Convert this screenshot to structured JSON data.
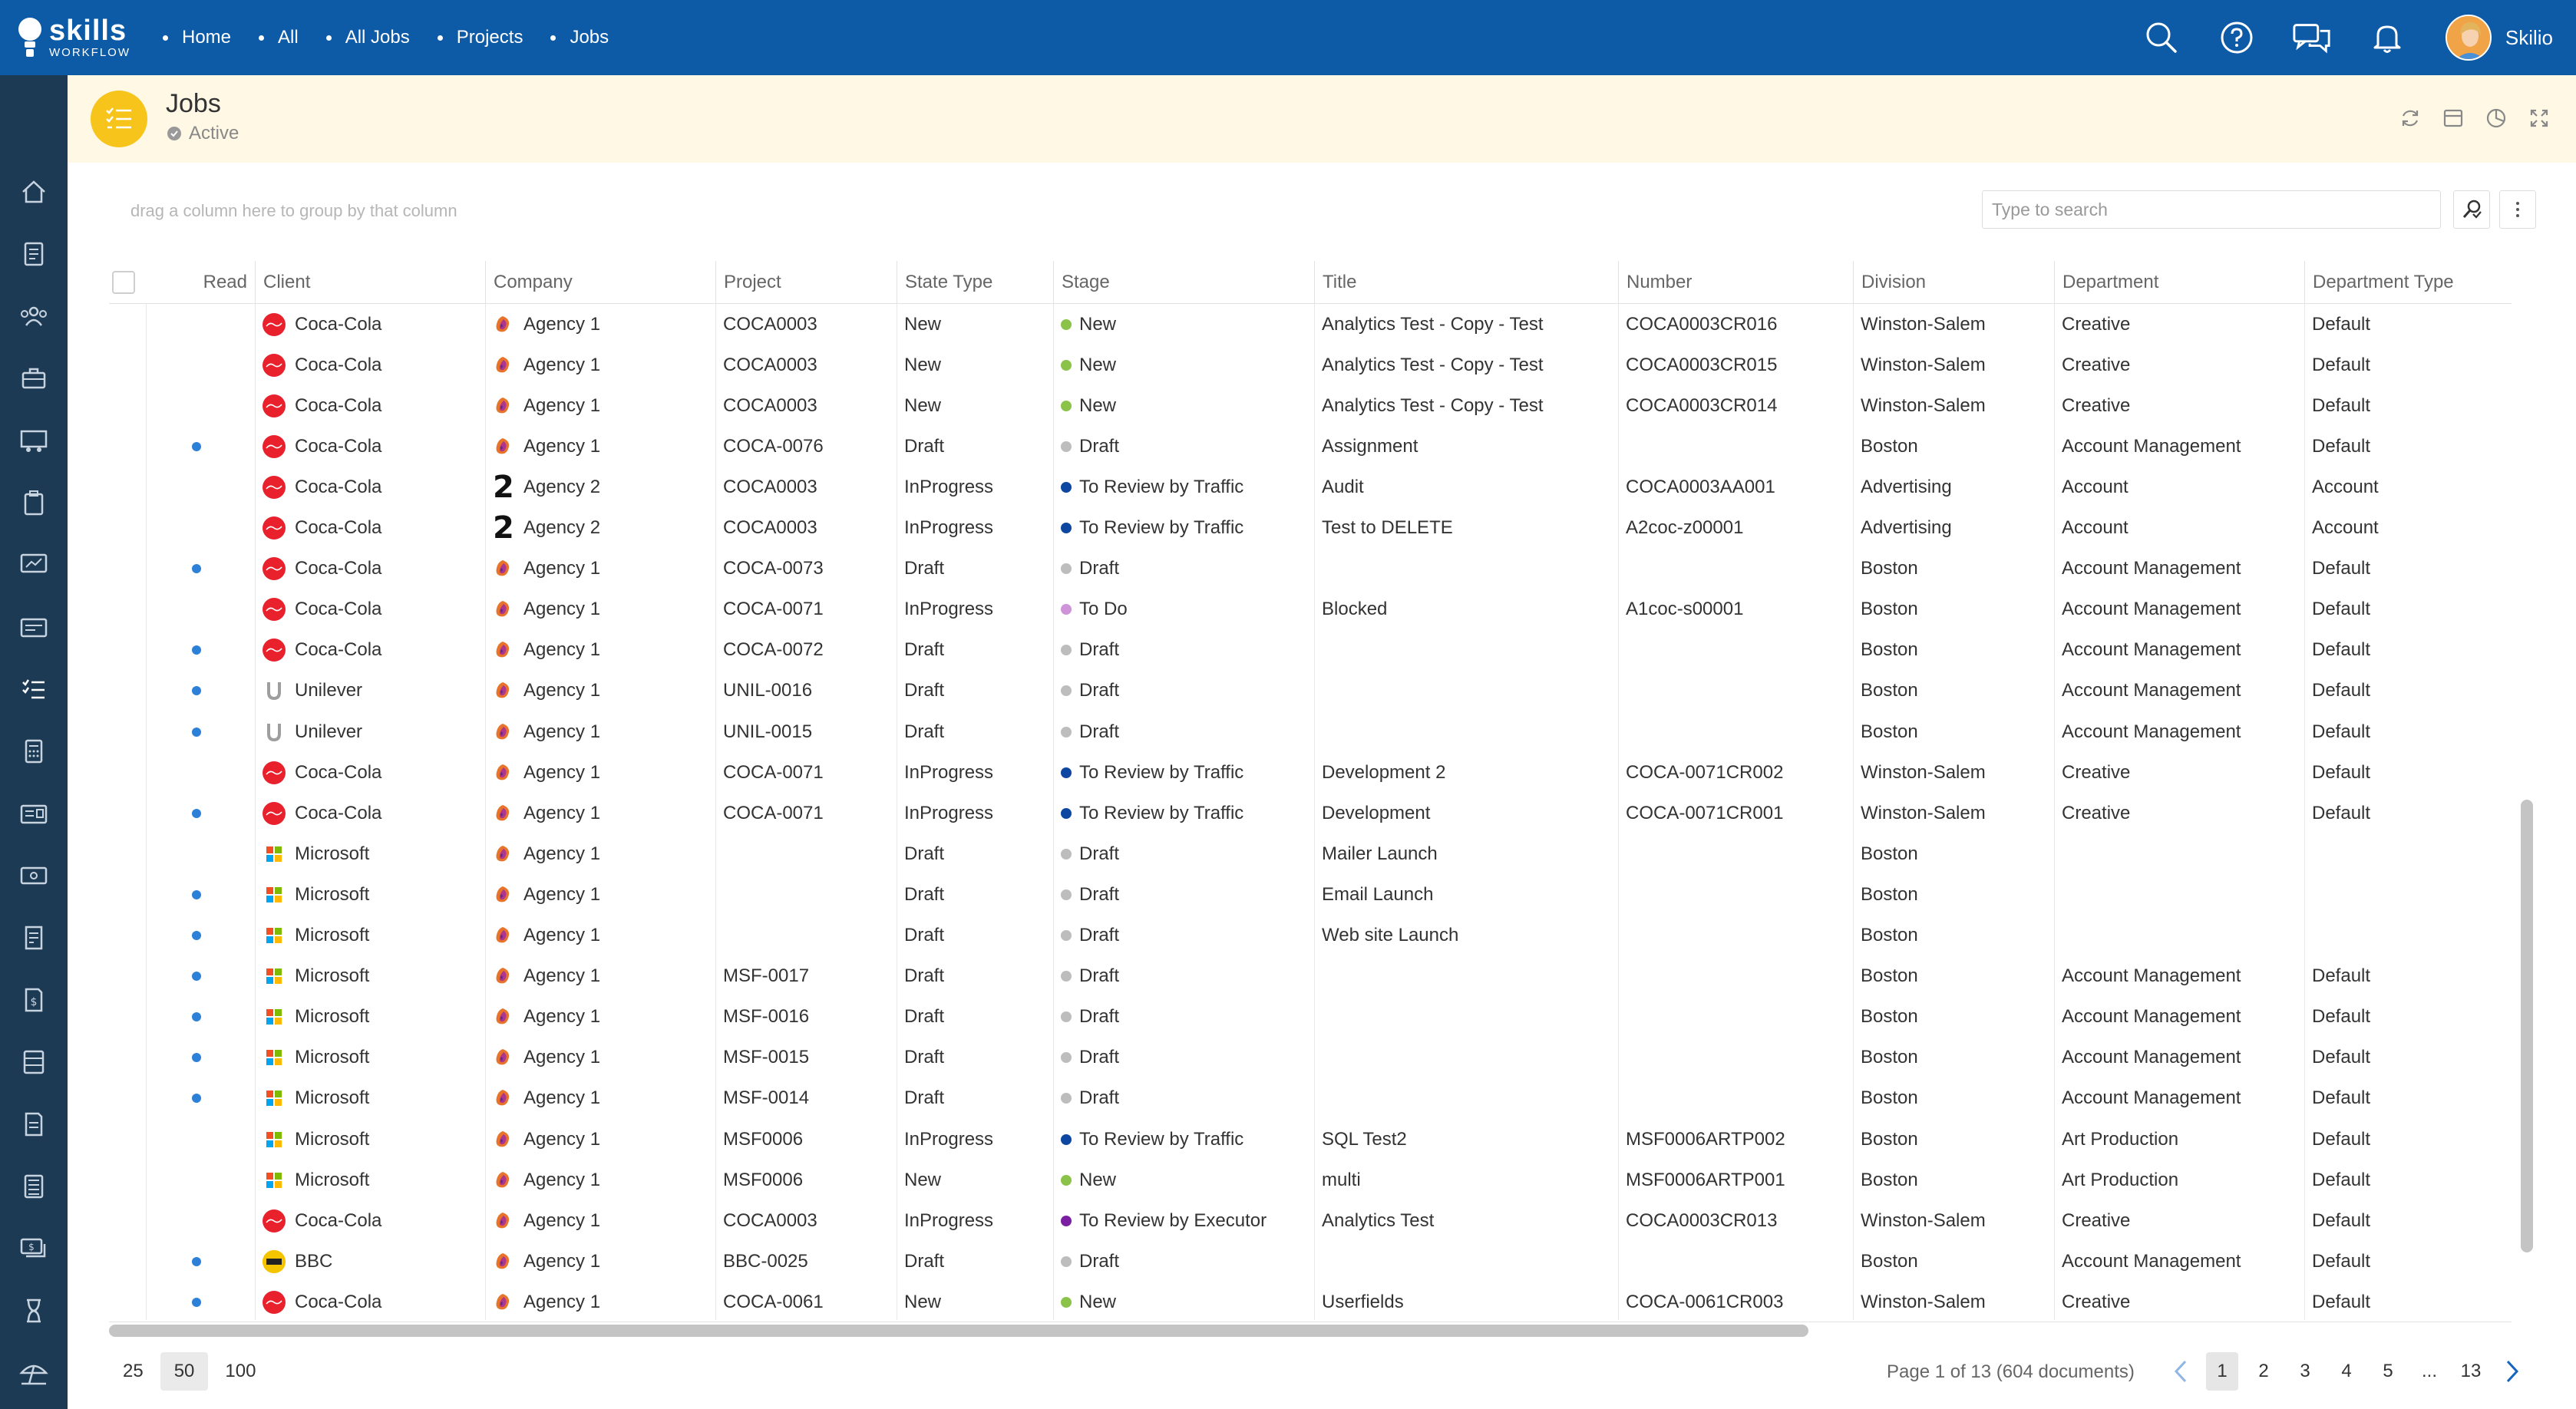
{
  "app": {
    "logo_line1": "skills",
    "logo_line2": "WORKFLOW"
  },
  "breadcrumbs": [
    "Home",
    "All",
    "All Jobs",
    "Projects",
    "Jobs"
  ],
  "user": {
    "name": "Skilio"
  },
  "page": {
    "title": "Jobs",
    "status": "Active"
  },
  "toolbar": {
    "group_hint": "drag a column here to group by that column",
    "search_placeholder": "Type to search"
  },
  "columns": [
    "Read",
    "Client",
    "Company",
    "Project",
    "State Type",
    "Stage",
    "Title",
    "Number",
    "Division",
    "Department",
    "Department Type"
  ],
  "stage_colors": {
    "New": "#8bc34a",
    "Draft": "#bdbdbd",
    "To Review by Traffic": "#0d47a1",
    "To Do": "#ce93d8",
    "To Review by Executor": "#7b1fa2"
  },
  "rows": [
    {
      "read": false,
      "client": "Coca-Cola",
      "company": "Agency 1",
      "project": "COCA0003",
      "state_type": "New",
      "stage": "New",
      "title": "Analytics Test - Copy - Test",
      "number": "COCA0003CR016",
      "division": "Winston-Salem",
      "department": "Creative",
      "department_type": "Default"
    },
    {
      "read": false,
      "client": "Coca-Cola",
      "company": "Agency 1",
      "project": "COCA0003",
      "state_type": "New",
      "stage": "New",
      "title": "Analytics Test - Copy - Test",
      "number": "COCA0003CR015",
      "division": "Winston-Salem",
      "department": "Creative",
      "department_type": "Default"
    },
    {
      "read": false,
      "client": "Coca-Cola",
      "company": "Agency 1",
      "project": "COCA0003",
      "state_type": "New",
      "stage": "New",
      "title": "Analytics Test - Copy - Test",
      "number": "COCA0003CR014",
      "division": "Winston-Salem",
      "department": "Creative",
      "department_type": "Default"
    },
    {
      "read": true,
      "client": "Coca-Cola",
      "company": "Agency 1",
      "project": "COCA-0076",
      "state_type": "Draft",
      "stage": "Draft",
      "title": "Assignment",
      "number": "",
      "division": "Boston",
      "department": "Account Management",
      "department_type": "Default"
    },
    {
      "read": false,
      "client": "Coca-Cola",
      "company": "Agency 2",
      "project": "COCA0003",
      "state_type": "InProgress",
      "stage": "To Review by Traffic",
      "title": "Audit",
      "number": "COCA0003AA001",
      "division": "Advertising",
      "department": "Account",
      "department_type": "Account"
    },
    {
      "read": false,
      "client": "Coca-Cola",
      "company": "Agency 2",
      "project": "COCA0003",
      "state_type": "InProgress",
      "stage": "To Review by Traffic",
      "title": "Test to DELETE",
      "number": "A2coc-z00001",
      "division": "Advertising",
      "department": "Account",
      "department_type": "Account"
    },
    {
      "read": true,
      "client": "Coca-Cola",
      "company": "Agency 1",
      "project": "COCA-0073",
      "state_type": "Draft",
      "stage": "Draft",
      "title": "",
      "number": "",
      "division": "Boston",
      "department": "Account Management",
      "department_type": "Default"
    },
    {
      "read": false,
      "client": "Coca-Cola",
      "company": "Agency 1",
      "project": "COCA-0071",
      "state_type": "InProgress",
      "stage": "To Do",
      "title": "Blocked",
      "number": "A1coc-s00001",
      "division": "Boston",
      "department": "Account Management",
      "department_type": "Default"
    },
    {
      "read": true,
      "client": "Coca-Cola",
      "company": "Agency 1",
      "project": "COCA-0072",
      "state_type": "Draft",
      "stage": "Draft",
      "title": "",
      "number": "",
      "division": "Boston",
      "department": "Account Management",
      "department_type": "Default"
    },
    {
      "read": true,
      "client": "Unilever",
      "company": "Agency 1",
      "project": "UNIL-0016",
      "state_type": "Draft",
      "stage": "Draft",
      "title": "",
      "number": "",
      "division": "Boston",
      "department": "Account Management",
      "department_type": "Default"
    },
    {
      "read": true,
      "client": "Unilever",
      "company": "Agency 1",
      "project": "UNIL-0015",
      "state_type": "Draft",
      "stage": "Draft",
      "title": "",
      "number": "",
      "division": "Boston",
      "department": "Account Management",
      "department_type": "Default"
    },
    {
      "read": false,
      "client": "Coca-Cola",
      "company": "Agency 1",
      "project": "COCA-0071",
      "state_type": "InProgress",
      "stage": "To Review by Traffic",
      "title": "Development 2",
      "number": "COCA-0071CR002",
      "division": "Winston-Salem",
      "department": "Creative",
      "department_type": "Default"
    },
    {
      "read": true,
      "client": "Coca-Cola",
      "company": "Agency 1",
      "project": "COCA-0071",
      "state_type": "InProgress",
      "stage": "To Review by Traffic",
      "title": "Development",
      "number": "COCA-0071CR001",
      "division": "Winston-Salem",
      "department": "Creative",
      "department_type": "Default"
    },
    {
      "read": false,
      "client": "Microsoft",
      "company": "Agency 1",
      "project": "",
      "state_type": "Draft",
      "stage": "Draft",
      "title": "Mailer Launch",
      "number": "",
      "division": "Boston",
      "department": "",
      "department_type": ""
    },
    {
      "read": true,
      "client": "Microsoft",
      "company": "Agency 1",
      "project": "",
      "state_type": "Draft",
      "stage": "Draft",
      "title": "Email Launch",
      "number": "",
      "division": "Boston",
      "department": "",
      "department_type": ""
    },
    {
      "read": true,
      "client": "Microsoft",
      "company": "Agency 1",
      "project": "",
      "state_type": "Draft",
      "stage": "Draft",
      "title": "Web site Launch",
      "number": "",
      "division": "Boston",
      "department": "",
      "department_type": ""
    },
    {
      "read": true,
      "client": "Microsoft",
      "company": "Agency 1",
      "project": "MSF-0017",
      "state_type": "Draft",
      "stage": "Draft",
      "title": "",
      "number": "",
      "division": "Boston",
      "department": "Account Management",
      "department_type": "Default"
    },
    {
      "read": true,
      "client": "Microsoft",
      "company": "Agency 1",
      "project": "MSF-0016",
      "state_type": "Draft",
      "stage": "Draft",
      "title": "",
      "number": "",
      "division": "Boston",
      "department": "Account Management",
      "department_type": "Default"
    },
    {
      "read": true,
      "client": "Microsoft",
      "company": "Agency 1",
      "project": "MSF-0015",
      "state_type": "Draft",
      "stage": "Draft",
      "title": "",
      "number": "",
      "division": "Boston",
      "department": "Account Management",
      "department_type": "Default"
    },
    {
      "read": true,
      "client": "Microsoft",
      "company": "Agency 1",
      "project": "MSF-0014",
      "state_type": "Draft",
      "stage": "Draft",
      "title": "",
      "number": "",
      "division": "Boston",
      "department": "Account Management",
      "department_type": "Default"
    },
    {
      "read": false,
      "client": "Microsoft",
      "company": "Agency 1",
      "project": "MSF0006",
      "state_type": "InProgress",
      "stage": "To Review by Traffic",
      "title": "SQL Test2",
      "number": "MSF0006ARTP002",
      "division": "Boston",
      "department": "Art Production",
      "department_type": "Default"
    },
    {
      "read": false,
      "client": "Microsoft",
      "company": "Agency 1",
      "project": "MSF0006",
      "state_type": "New",
      "stage": "New",
      "title": "multi",
      "number": "MSF0006ARTP001",
      "division": "Boston",
      "department": "Art Production",
      "department_type": "Default"
    },
    {
      "read": false,
      "client": "Coca-Cola",
      "company": "Agency 1",
      "project": "COCA0003",
      "state_type": "InProgress",
      "stage": "To Review by Executor",
      "title": "Analytics Test",
      "number": "COCA0003CR013",
      "division": "Winston-Salem",
      "department": "Creative",
      "department_type": "Default"
    },
    {
      "read": true,
      "client": "BBC",
      "company": "Agency 1",
      "project": "BBC-0025",
      "state_type": "Draft",
      "stage": "Draft",
      "title": "",
      "number": "",
      "division": "Boston",
      "department": "Account Management",
      "department_type": "Default"
    },
    {
      "read": true,
      "client": "Coca-Cola",
      "company": "Agency 1",
      "project": "COCA-0061",
      "state_type": "New",
      "stage": "New",
      "title": "Userfields",
      "number": "COCA-0061CR003",
      "division": "Winston-Salem",
      "department": "Creative",
      "department_type": "Default"
    }
  ],
  "footer": {
    "page_sizes": [
      "25",
      "50",
      "100"
    ],
    "active_page_size": "50",
    "page_info": "Page 1 of 13 (604 documents)",
    "pages": [
      "1",
      "2",
      "3",
      "4",
      "5",
      "...",
      "13"
    ],
    "active_page": "1"
  }
}
